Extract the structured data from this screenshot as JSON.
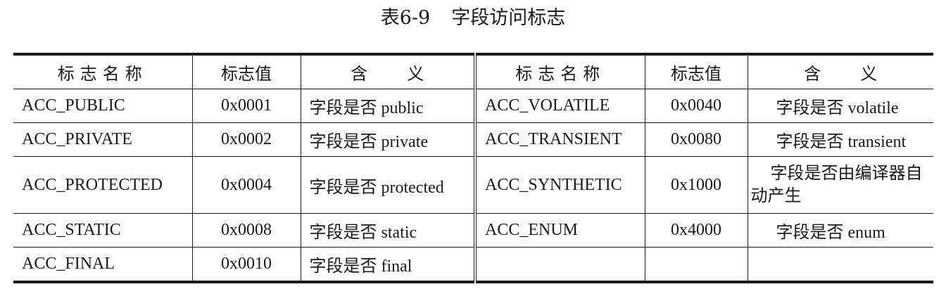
{
  "caption": {
    "number": "表6-9",
    "title": "字段访问标志"
  },
  "headers": {
    "name": "标志名称",
    "value": "标志值",
    "meaning": "含义"
  },
  "left_rows": [
    {
      "name": "ACC_PUBLIC",
      "value": "0x0001",
      "meaning": "字段是否 public"
    },
    {
      "name": "ACC_PRIVATE",
      "value": "0x0002",
      "meaning": "字段是否 private"
    },
    {
      "name": "ACC_PROTECTED",
      "value": "0x0004",
      "meaning": "字段是否 protected"
    },
    {
      "name": "ACC_STATIC",
      "value": "0x0008",
      "meaning": "字段是否 static"
    },
    {
      "name": "ACC_FINAL",
      "value": "0x0010",
      "meaning": "字段是否 final"
    }
  ],
  "right_rows": [
    {
      "name": "ACC_VOLATILE",
      "value": "0x0040",
      "meaning": "字段是否 volatile"
    },
    {
      "name": "ACC_TRANSIENT",
      "value": "0x0080",
      "meaning": "字段是否 transient"
    },
    {
      "name": "ACC_SYNTHETIC",
      "value": "0x1000",
      "meaning": "字段是否由编译器自动产生"
    },
    {
      "name": "ACC_ENUM",
      "value": "0x4000",
      "meaning": "字段是否 enum"
    },
    {
      "name": "",
      "value": "",
      "meaning": ""
    }
  ]
}
